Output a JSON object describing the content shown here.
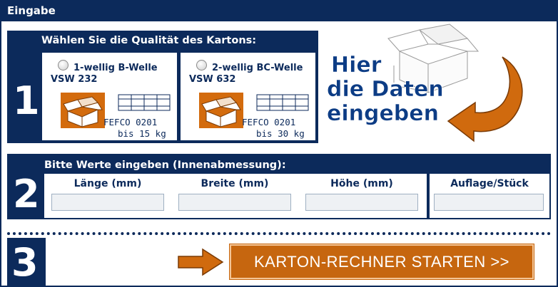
{
  "header": {
    "title": "Eingabe"
  },
  "steps": {
    "one": "1",
    "two": "2",
    "three": "3"
  },
  "quality": {
    "title": "Wählen Sie die Qualität des Kartons:",
    "options": [
      {
        "name": "1-wellig B-Welle",
        "code": "VSW 232",
        "fefco": "FEFCO 0201",
        "weight": "bis 15 kg"
      },
      {
        "name": "2-wellig BC-Welle",
        "code": "VSW 632",
        "fefco": "FEFCO 0201",
        "weight": "bis 30 kg"
      }
    ]
  },
  "hint": {
    "line1": "Hier",
    "line2": "die Daten",
    "line3": "eingeben"
  },
  "dimensions": {
    "title": "Bitte Werte eingeben (Innenabmessung):",
    "columns": [
      "Länge (mm)",
      "Breite (mm)",
      "Höhe (mm)"
    ],
    "quantity_label": "Auflage/Stück"
  },
  "start": {
    "label": "KARTON-RECHNER STARTEN >>"
  },
  "colors": {
    "navy": "#0c2a5b",
    "orange": "#c6660f",
    "hint_blue": "#0c3c85"
  },
  "icons": [
    "radio-button",
    "open-box-icon",
    "flat-carton-icon",
    "box-illustration",
    "curved-arrow-icon",
    "right-arrow-icon"
  ]
}
